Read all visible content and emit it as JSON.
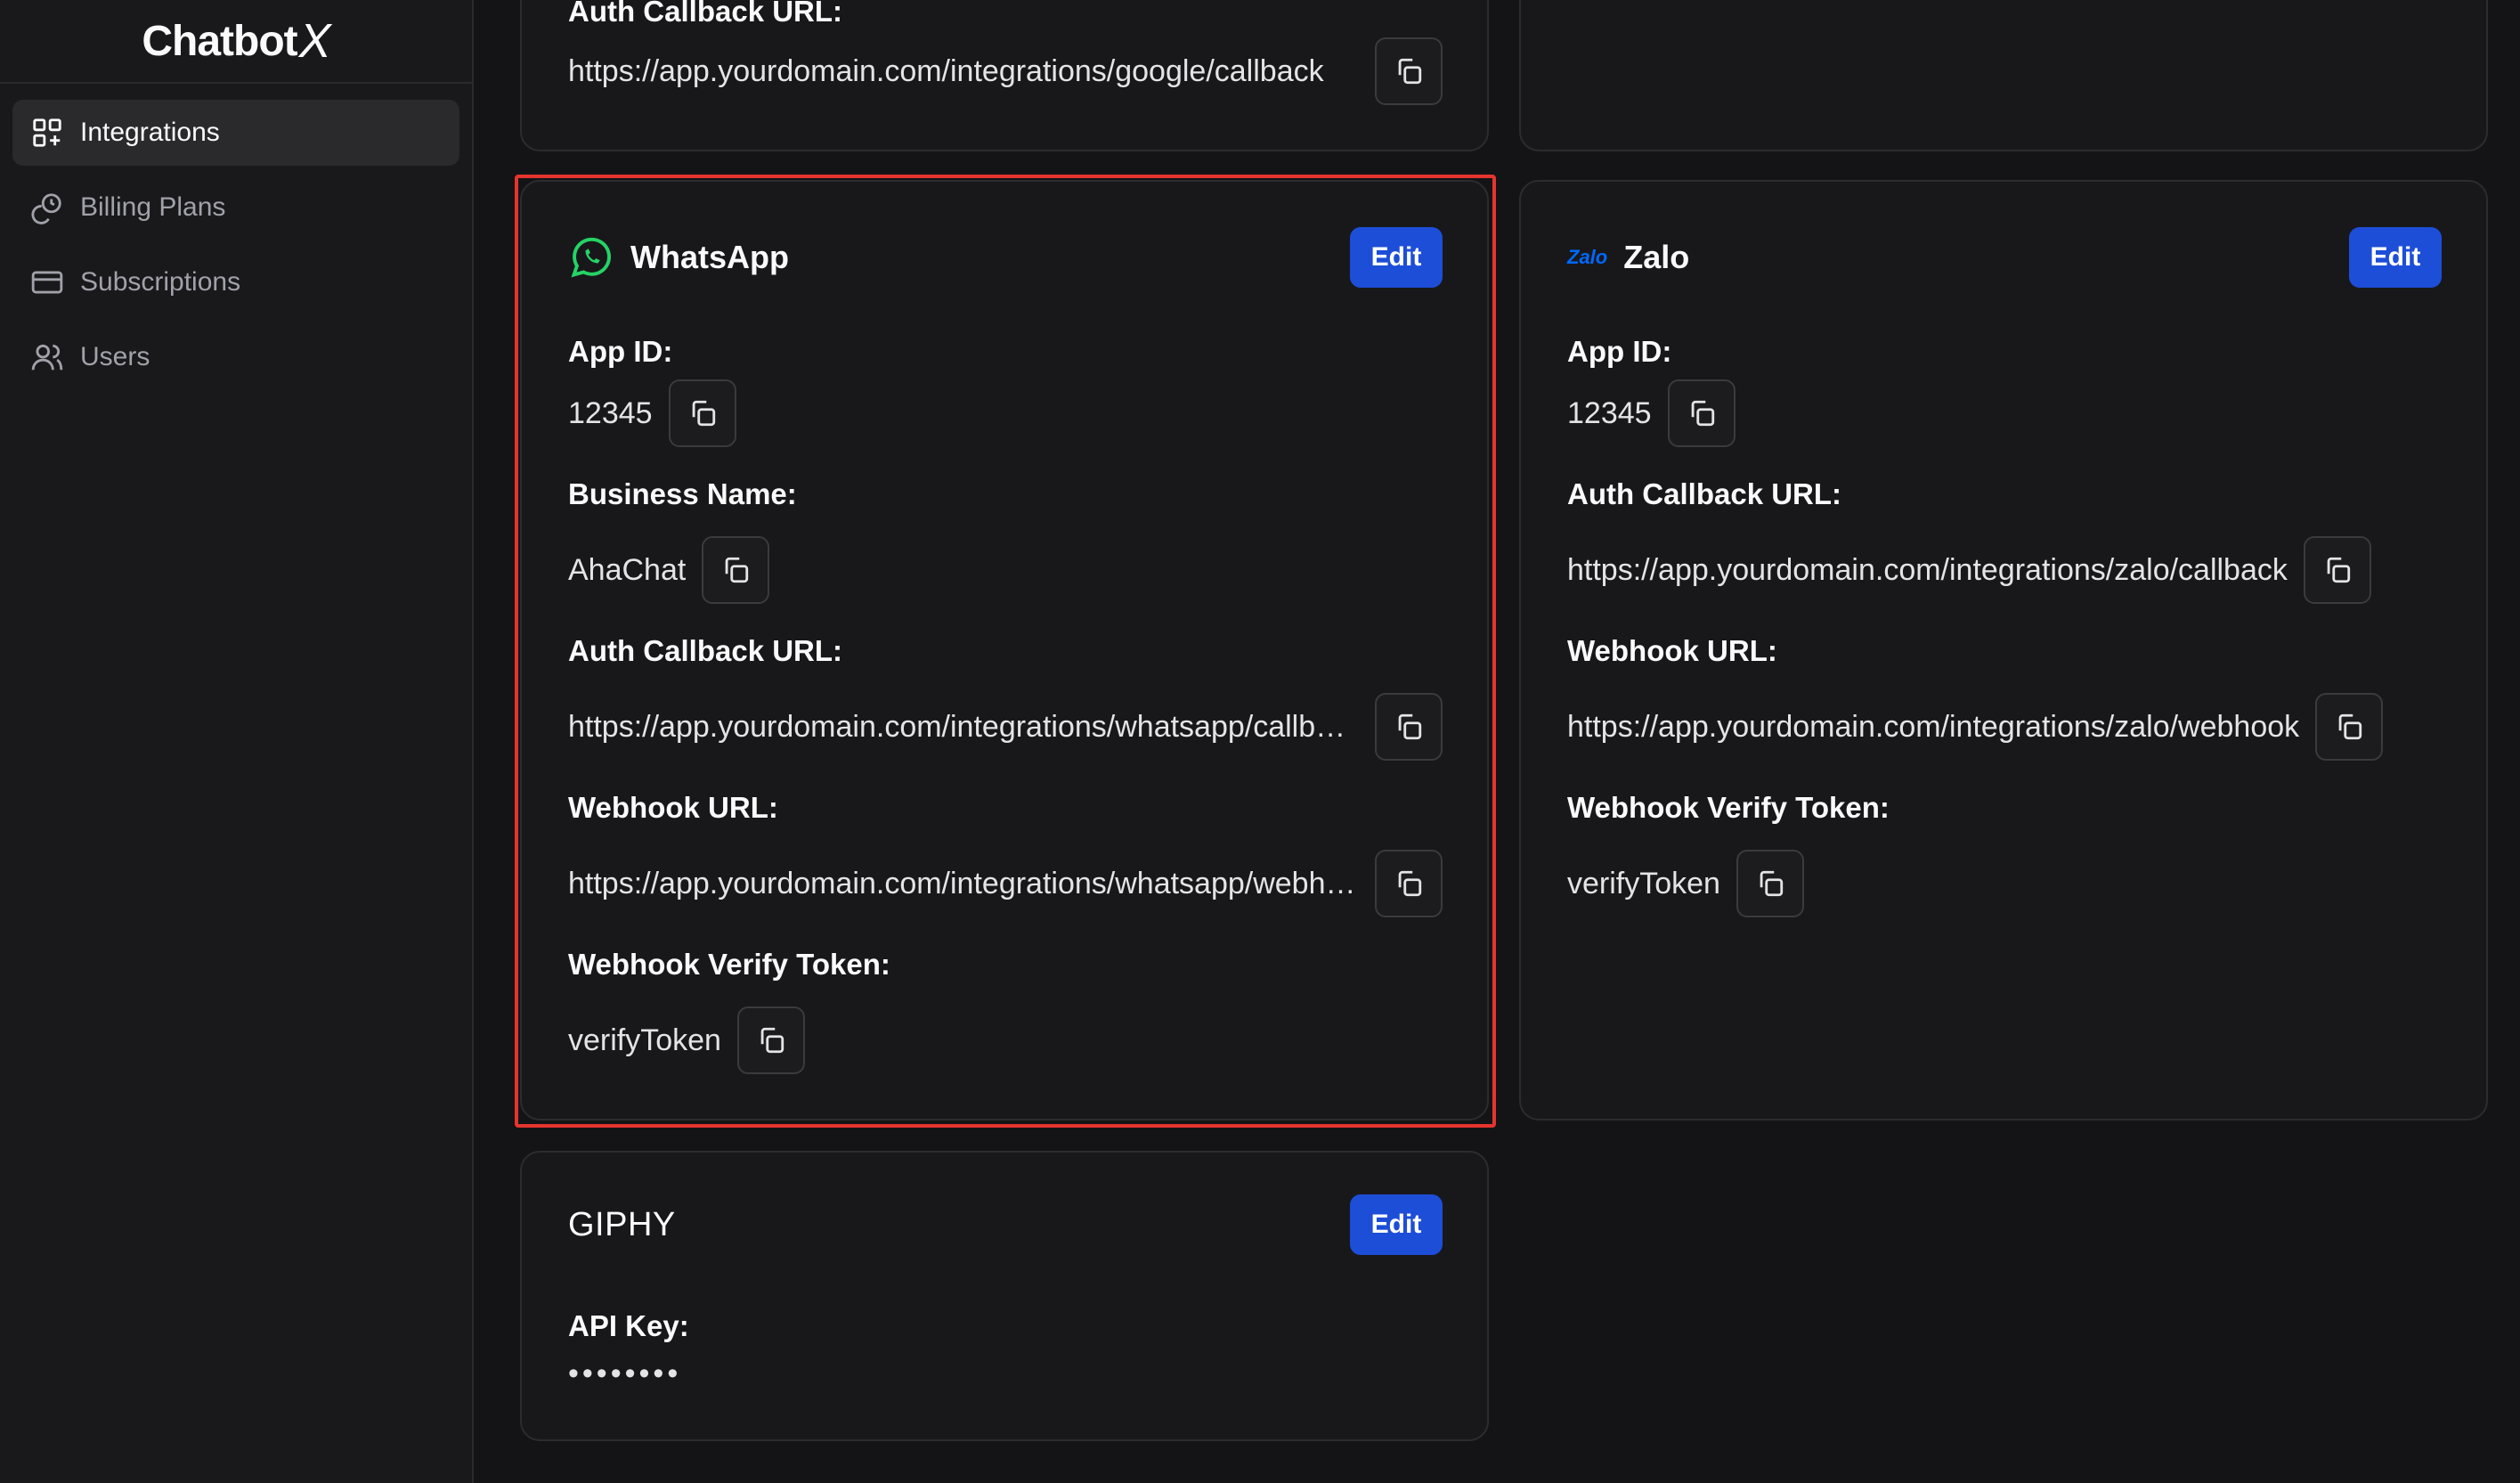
{
  "app": {
    "logo_text": "Chatbot",
    "logo_suffix": "X"
  },
  "sidebar": {
    "items": [
      {
        "label": "Integrations",
        "icon": "integrations-icon",
        "active": true
      },
      {
        "label": "Billing Plans",
        "icon": "billing-icon",
        "active": false
      },
      {
        "label": "Subscriptions",
        "icon": "card-icon",
        "active": false
      },
      {
        "label": "Users",
        "icon": "users-icon",
        "active": false
      }
    ]
  },
  "google_card": {
    "label": "Auth Callback URL:",
    "auth_callback_url": "https://app.yourdomain.com/integrations/google/callback"
  },
  "whatsapp": {
    "title": "WhatsApp",
    "edit_label": "Edit",
    "app_id_label": "App ID:",
    "app_id": "12345",
    "business_name_label": "Business Name:",
    "business_name": "AhaChat",
    "auth_callback_label": "Auth Callback URL:",
    "auth_callback_url": "https://app.yourdomain.com/integrations/whatsapp/callback",
    "webhook_label": "Webhook URL:",
    "webhook_url": "https://app.yourdomain.com/integrations/whatsapp/webhook",
    "verify_token_label": "Webhook Verify Token:",
    "verify_token": "verifyToken"
  },
  "zalo": {
    "logo_text": "Zalo",
    "title": "Zalo",
    "edit_label": "Edit",
    "app_id_label": "App ID:",
    "app_id": "12345",
    "auth_callback_label": "Auth Callback URL:",
    "auth_callback_url": "https://app.yourdomain.com/integrations/zalo/callback",
    "webhook_label": "Webhook URL:",
    "webhook_url": "https://app.yourdomain.com/integrations/zalo/webhook",
    "verify_token_label": "Webhook Verify Token:",
    "verify_token": "verifyToken"
  },
  "giphy": {
    "title": "GIPHY",
    "edit_label": "Edit",
    "api_key_label": "API Key:",
    "api_key_masked": "••••••••"
  },
  "colors": {
    "accent": "#1d4ed8",
    "whatsapp_green": "#25d366",
    "zalo_blue": "#0068ff",
    "highlight_red": "#e5342f"
  }
}
